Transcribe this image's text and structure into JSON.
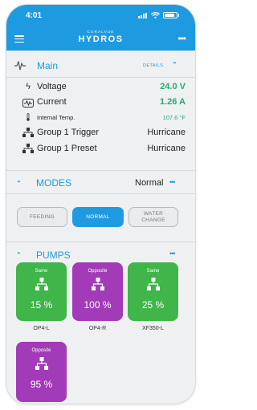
{
  "status_bar": {
    "time": "4:01"
  },
  "header": {
    "brand_small": "CORALVUE",
    "brand_big": "HYDROS",
    "more": "•••"
  },
  "main": {
    "title": "Main",
    "details": "DETAILS",
    "rows": [
      {
        "label": "Voltage",
        "value": "24.0 V"
      },
      {
        "label": "Current",
        "value": "1.26 A"
      },
      {
        "label": "Internal Temp.",
        "value": "107.6 °F"
      },
      {
        "label": "Group 1 Trigger",
        "value": "Hurricane"
      },
      {
        "label": "Group 1 Preset",
        "value": "Hurricane"
      }
    ]
  },
  "modes": {
    "title": "MODES",
    "current": "Normal",
    "more": "•••",
    "buttons": [
      {
        "label": "FEEDING",
        "active": false
      },
      {
        "label": "NORMAL",
        "active": true
      },
      {
        "label": "WATER\nCHANGE",
        "active": false
      }
    ]
  },
  "pumps": {
    "title": "PUMPS",
    "more": "•••",
    "items": [
      {
        "mode": "Same",
        "value": "15 %",
        "name": "OP4-L",
        "color": "#3fb54a"
      },
      {
        "mode": "Opposite",
        "value": "100 %",
        "name": "OP4-R",
        "color": "#a23bb8"
      },
      {
        "mode": "Same",
        "value": "25 %",
        "name": "XF350-L",
        "color": "#3fb54a"
      },
      {
        "mode": "Opposite",
        "value": "95 %",
        "name": "",
        "color": "#a23bb8"
      }
    ]
  },
  "colors": {
    "accent": "#1e9be0",
    "green": "#2ea870",
    "pump_green": "#3fb54a",
    "pump_purple": "#a23bb8"
  }
}
